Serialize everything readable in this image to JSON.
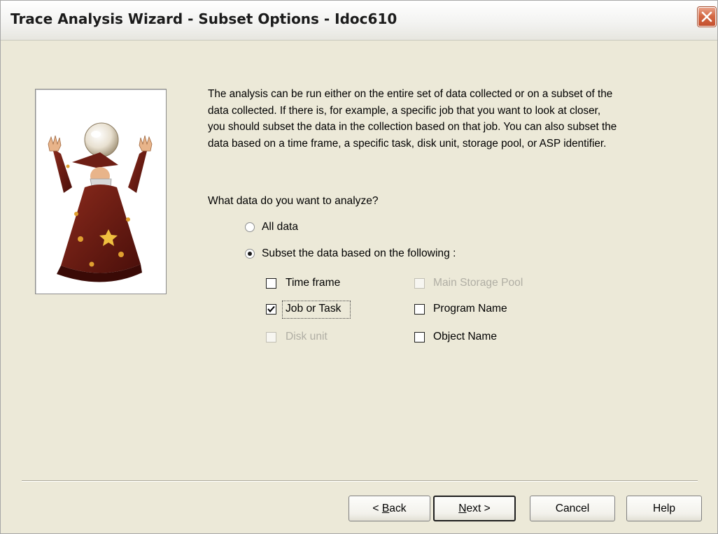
{
  "window": {
    "title": "Trace Analysis Wizard - Subset Options - Idoc610",
    "close_icon": "close-icon"
  },
  "description": "The analysis can be run either on the entire set of data collected or on a subset of the data collected. If there is, for example, a specific job that you want to look at closer, you should subset the data in the collection based on that job. You can also subset the data based on a time frame, a specific task, disk unit, storage pool, or ASP identifier.",
  "question": "What data do you want to analyze?",
  "radios": {
    "all_data": {
      "label": "All data",
      "selected": false
    },
    "subset": {
      "label": "Subset the data based on the following :",
      "selected": true
    }
  },
  "checkboxes": {
    "time_frame": {
      "label": "Time frame",
      "checked": false,
      "enabled": true
    },
    "job_or_task": {
      "label": "Job or Task",
      "checked": true,
      "enabled": true
    },
    "disk_unit": {
      "label": "Disk unit",
      "checked": false,
      "enabled": false
    },
    "main_storage_pool": {
      "label": "Main Storage Pool",
      "checked": false,
      "enabled": false
    },
    "program_name": {
      "label": "Program Name",
      "checked": false,
      "enabled": true
    },
    "object_name": {
      "label": "Object Name",
      "checked": false,
      "enabled": true
    }
  },
  "buttons": {
    "back": {
      "prefix": "< ",
      "mnemonic": "B",
      "rest": "ack"
    },
    "next": {
      "mnemonic": "N",
      "rest": "ext >"
    },
    "cancel": "Cancel",
    "help": "Help"
  },
  "illustration": "wizard-image"
}
